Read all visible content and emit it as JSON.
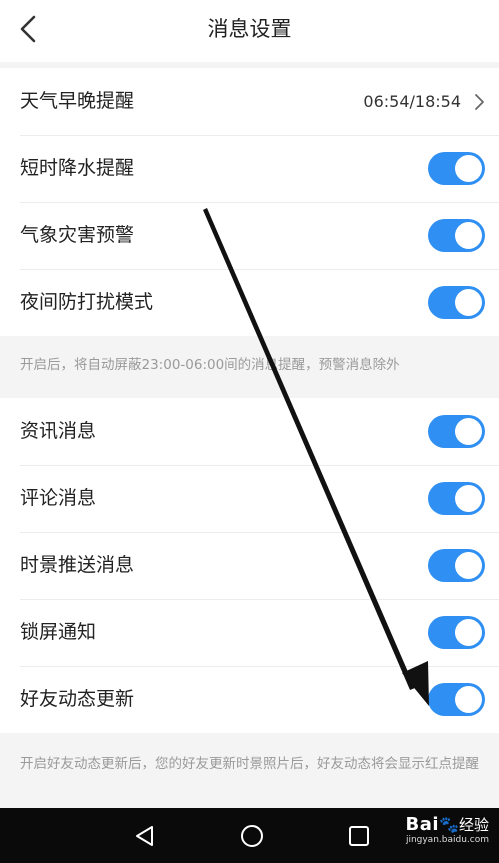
{
  "header": {
    "title": "消息设置",
    "back_icon": "back-chevron-icon"
  },
  "section1": {
    "items": [
      {
        "label": "天气早晚提醒",
        "value": "06:54/18:54",
        "type": "link"
      },
      {
        "label": "短时降水提醒",
        "enabled": true,
        "type": "toggle"
      },
      {
        "label": "气象灾害预警",
        "enabled": true,
        "type": "toggle"
      },
      {
        "label": "夜间防打扰模式",
        "enabled": true,
        "type": "toggle"
      }
    ],
    "note": "开启后，将自动屏蔽23:00-06:00间的消息提醒，预警消息除外"
  },
  "section2": {
    "items": [
      {
        "label": "资讯消息",
        "enabled": true
      },
      {
        "label": "评论消息",
        "enabled": true
      },
      {
        "label": "时景推送消息",
        "enabled": true
      },
      {
        "label": "锁屏通知",
        "enabled": true
      },
      {
        "label": "好友动态更新",
        "enabled": true
      }
    ],
    "note": "开启好友动态更新后，您的好友更新时景照片后，好友动态将会显示红点提醒"
  },
  "navbar": {
    "buttons": [
      "back-triangle-icon",
      "home-circle-icon",
      "recents-square-icon"
    ]
  },
  "watermark": {
    "brand": "Bai",
    "brand_suffix": "经验",
    "url": "jingyan.baidu.com"
  },
  "colors": {
    "toggle_on": "#2f8ff3",
    "background": "#f4f4f4",
    "note_text": "#9a9a9a"
  }
}
